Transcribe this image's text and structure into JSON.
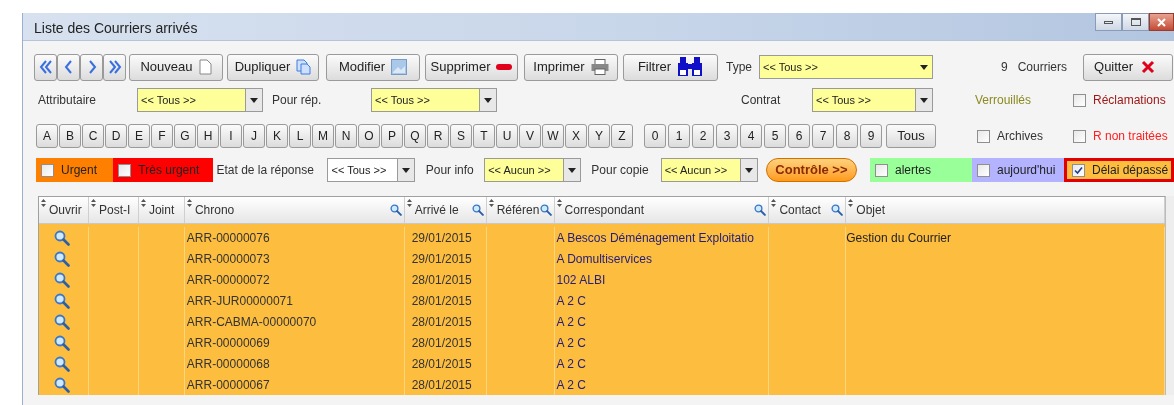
{
  "window": {
    "title": "Liste des Courriers arrivés"
  },
  "toolbar": {
    "buttons": [
      {
        "label": "Nouveau",
        "kind": "new"
      },
      {
        "label": "Dupliquer",
        "kind": "duplicate"
      },
      {
        "label": "Modifier",
        "kind": "edit"
      },
      {
        "label": "Supprimer",
        "kind": "delete"
      },
      {
        "label": "Imprimer",
        "kind": "print"
      },
      {
        "label": "Filtrer",
        "kind": "filter"
      }
    ],
    "type": {
      "label": "Type",
      "value": "<< Tous >>"
    },
    "count": "9",
    "count_label": "Courriers",
    "quit": "Quitter"
  },
  "row2": {
    "filters": [
      {
        "label": "Attributaire",
        "value": "<< Tous >>"
      },
      {
        "label": "Pour rép.",
        "value": "<< Tous >>"
      }
    ],
    "contrat": {
      "label": "Contrat",
      "value": "<< Tous >>"
    },
    "locked": "Verrouillés",
    "claims": {
      "label": "Réclamations",
      "checked": false
    }
  },
  "row3": {
    "letters": [
      "A",
      "B",
      "C",
      "D",
      "E",
      "F",
      "G",
      "H",
      "I",
      "J",
      "K",
      "L",
      "M",
      "N",
      "O",
      "P",
      "Q",
      "R",
      "S",
      "T",
      "U",
      "V",
      "W",
      "X",
      "Y",
      "Z"
    ],
    "digits": [
      "0",
      "1",
      "2",
      "3",
      "4",
      "5",
      "6",
      "7",
      "8",
      "9"
    ],
    "all": "Tous",
    "archives": {
      "label": "Archives",
      "checked": false
    },
    "unprocessed": {
      "label": "R non traitées",
      "checked": false
    }
  },
  "row4": {
    "priority_flags": [
      {
        "label": "Urgent",
        "checked": false,
        "color": "#ff8000"
      },
      {
        "label": "Très urgent",
        "checked": false,
        "color": "#ff0000"
      }
    ],
    "filters": [
      {
        "label": "Etat de la réponse",
        "value": "<< Tous >>",
        "color": "#ffffff"
      },
      {
        "label": "Pour info",
        "value": "<< Aucun >>",
        "color": "#ffff99"
      },
      {
        "label": "Pour copie",
        "value": "<< Aucun >>",
        "color": "#ffff99"
      }
    ],
    "control": "Contrôle >>",
    "period_flags": [
      {
        "label": "alertes",
        "checked": false,
        "color": "#99ff99",
        "highlighted": false
      },
      {
        "label": "aujourd'hui",
        "checked": false,
        "color": "#b3b3ff",
        "highlighted": false
      },
      {
        "label": "Délai dépassé",
        "checked": true,
        "color": "#fdbd3f",
        "highlighted": true
      }
    ]
  },
  "table": {
    "columns": [
      {
        "label": "Ouvrir",
        "searchable": false
      },
      {
        "label": "Post-I",
        "searchable": false
      },
      {
        "label": "Joint",
        "searchable": false
      },
      {
        "label": "Chrono",
        "searchable": true
      },
      {
        "label": "Arrivé le",
        "searchable": true
      },
      {
        "label": "Référen",
        "searchable": true
      },
      {
        "label": "Correspondant",
        "searchable": true
      },
      {
        "label": "Contact",
        "searchable": true
      },
      {
        "label": "Objet",
        "searchable": false
      }
    ],
    "rows": [
      {
        "chrono": "ARR-00000076",
        "date": "29/01/2015",
        "correspondent": "A Bescos Déménagement Exploitatio",
        "subject": "Gestion du Courrier"
      },
      {
        "chrono": "ARR-00000073",
        "date": "29/01/2015",
        "correspondent": "A Domultiservices"
      },
      {
        "chrono": "ARR-00000072",
        "date": "28/01/2015",
        "correspondent": "102 ALBI"
      },
      {
        "chrono": "ARR-JUR00000071",
        "date": "28/01/2015",
        "correspondent": "A 2 C"
      },
      {
        "chrono": "ARR-CABMA-00000070",
        "date": "28/01/2015",
        "correspondent": "A 2 C"
      },
      {
        "chrono": "ARR-00000069",
        "date": "28/01/2015",
        "correspondent": "A 2 C"
      },
      {
        "chrono": "ARR-00000068",
        "date": "28/01/2015",
        "correspondent": "A 2 C"
      },
      {
        "chrono": "ARR-00000067",
        "date": "28/01/2015",
        "correspondent": "A 2 C"
      }
    ]
  }
}
